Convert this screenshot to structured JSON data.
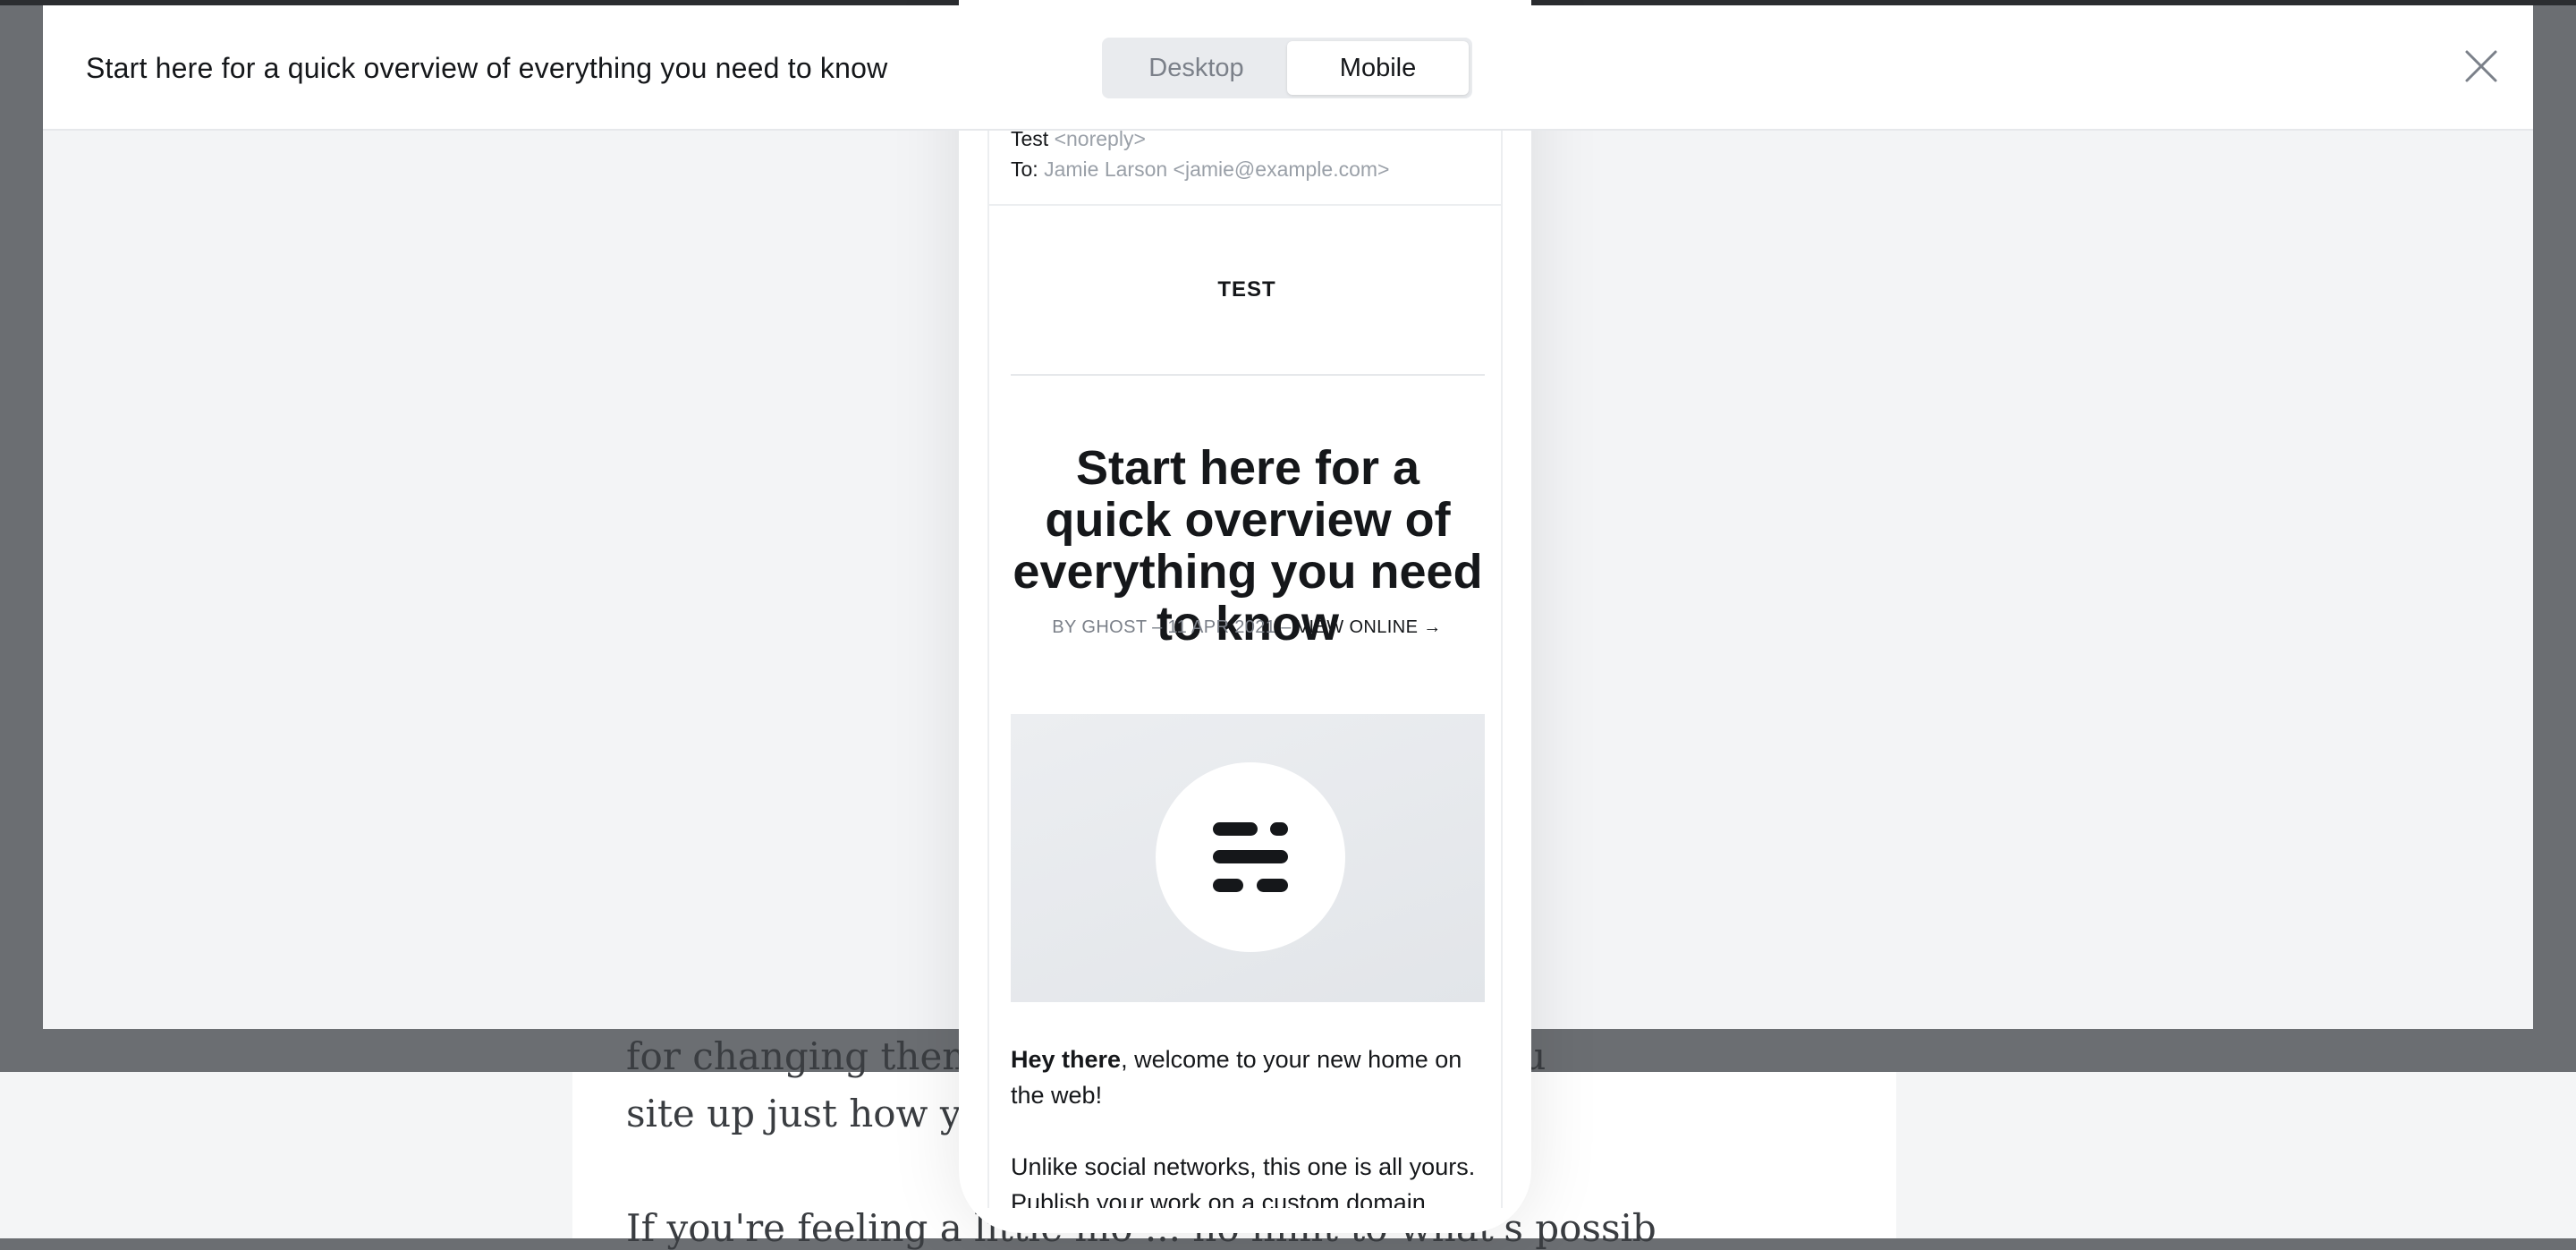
{
  "background_editor": {
    "line1": "for changing themes, co ... — so you can set you",
    "line2": "site up just how you like ... d.",
    "line3": "If you're feeling a little mo ... no limit to what's possib"
  },
  "modal": {
    "title": "Start here for a quick overview of everything you need to know",
    "toggle": {
      "desktop_label": "Desktop",
      "mobile_label": "Mobile",
      "active": "Mobile"
    },
    "close_icon": "close-icon"
  },
  "email": {
    "from_name": "Test",
    "from_address": "<noreply>",
    "to_label": "To:",
    "to_value": "Jamie Larson <jamie@example.com>",
    "site_name": "TEST",
    "post_title": "Start here for a quick overview of everything you need to know",
    "meta_prefix": "BY GHOST – 11 APR 2021 – ",
    "meta_link": "VIEW ONLINE →",
    "feature_icon": "ghost-logo-icon",
    "greeting_bold": "Hey there",
    "greeting_rest": ", welcome to your new home on the web!",
    "paragraph2": "Unlike social networks, this one is all yours. Publish your work on a custom domain, invite"
  },
  "colors": {
    "accent": "#15171a",
    "muted": "#9aa0a8",
    "panel_bg": "#f3f4f6",
    "overlay": "#6b6e72"
  }
}
